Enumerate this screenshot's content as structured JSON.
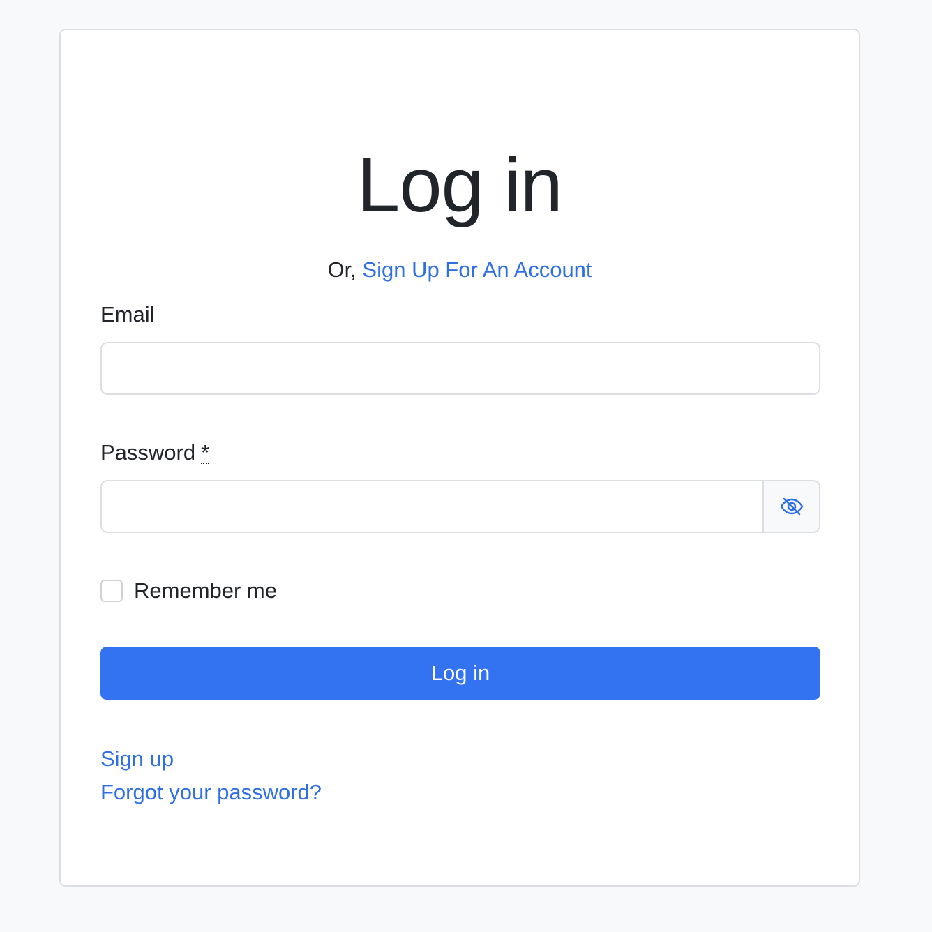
{
  "page": {
    "title": "Log in",
    "subtitle_prefix": "Or, ",
    "subtitle_link": "Sign Up For An Account"
  },
  "form": {
    "email_label": "Email",
    "email_value": "",
    "password_label": "Password",
    "password_required_marker": "*",
    "password_value": "",
    "remember_label": "Remember me",
    "remember_checked": false,
    "submit_label": "Log in"
  },
  "links": {
    "sign_up": "Sign up",
    "forgot_password": "Forgot your password?"
  },
  "colors": {
    "accent": "#3373f2",
    "link": "#2f6fe6",
    "background": "#f8f9fa",
    "card": "#ffffff",
    "border": "#dcdee1",
    "text": "#212529"
  },
  "icons": {
    "password_toggle": "eye-slash-icon"
  }
}
